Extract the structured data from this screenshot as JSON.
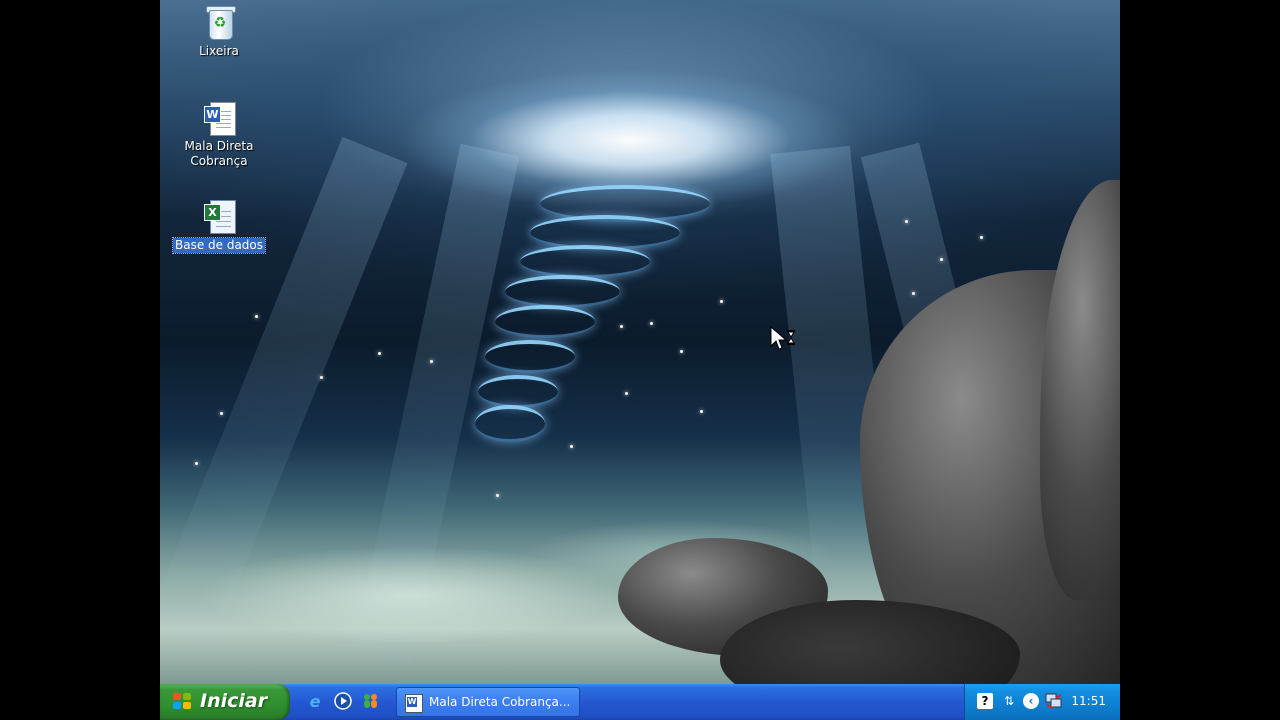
{
  "desktop": {
    "icons": [
      {
        "label": "Lixeira",
        "icon": "recycle-bin-icon"
      },
      {
        "label": "Mala Direta\nCobrança",
        "icon": "word-document-icon"
      },
      {
        "label": "Base de dados",
        "icon": "excel-workbook-icon",
        "selected": true
      }
    ]
  },
  "taskbar": {
    "start_label": "Iniciar",
    "quick_launch": [
      "internet-explorer-icon",
      "media-player-icon",
      "messenger-icon"
    ],
    "task_button_label": "Mala Direta Cobrança...",
    "tray_icons": [
      "help-icon",
      "arrows-icon",
      "back-chevron-icon",
      "network-icon"
    ],
    "clock": "11:51"
  },
  "colors": {
    "taskbar_blue": "#2458d2",
    "start_green": "#3a9a3a",
    "selection_blue": "#316ac5"
  }
}
